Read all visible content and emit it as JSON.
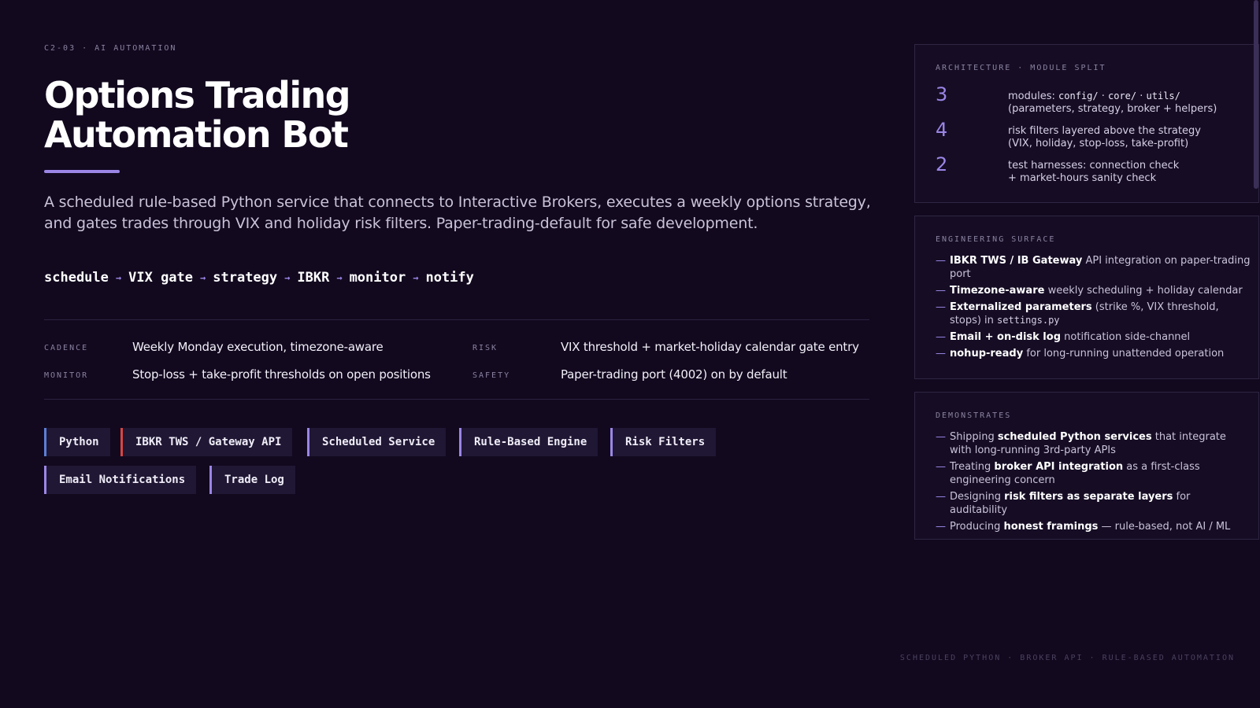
{
  "eyebrow": "C2-03 · AI AUTOMATION",
  "title": {
    "line1": "Options Trading",
    "line2": "Automation Bot"
  },
  "lede": "A scheduled rule-based Python service that connects to Interactive Brokers, executes a weekly options strategy, and gates trades through VIX and holiday risk filters. Paper-trading-default for safe development.",
  "pipeline": {
    "steps": [
      "schedule",
      "VIX gate",
      "strategy",
      "IBKR",
      "monitor",
      "notify"
    ],
    "arrow": "→"
  },
  "meta": {
    "cadence_label": "CADENCE",
    "cadence_value": "Weekly Monday execution, timezone-aware",
    "risk_label": "RISK",
    "risk_value": "VIX threshold + market-holiday calendar gate entry",
    "monitor_label": "MONITOR",
    "monitor_value": "Stop-loss + take-profit thresholds on open positions",
    "safety_label": "SAFETY",
    "safety_value": "Paper-trading port (4002) on by default"
  },
  "tags": [
    {
      "label": "Python",
      "accent": "#5b7fd6"
    },
    {
      "label": "IBKR TWS / Gateway API",
      "accent": "#d64545"
    },
    {
      "label": "Scheduled Service",
      "accent": "#9b86e6"
    },
    {
      "label": "Rule-Based Engine",
      "accent": "#9b86e6"
    },
    {
      "label": "Risk Filters",
      "accent": "#9b86e6"
    },
    {
      "label": "Email Notifications",
      "accent": "#9b86e6"
    },
    {
      "label": "Trade Log",
      "accent": "#9b86e6"
    }
  ],
  "architecture": {
    "title": "ARCHITECTURE · MODULE SPLIT",
    "rows": [
      {
        "num": "3",
        "prefix": "modules: ",
        "code1": "config/",
        "sep1": " · ",
        "code2": "core/",
        "sep2": " · ",
        "code3": "utils/",
        "line2": "(parameters, strategy, broker + helpers)"
      },
      {
        "num": "4",
        "line1": "risk filters layered above the strategy",
        "line2": "(VIX, holiday, stop-loss, take-profit)"
      },
      {
        "num": "2",
        "line1": "test harnesses: connection check",
        "line2": "+ market-hours sanity check"
      }
    ]
  },
  "engineering": {
    "title": "ENGINEERING SURFACE",
    "items": [
      {
        "bold": "IBKR TWS / IB Gateway",
        "rest": " API integration on paper-trading port"
      },
      {
        "bold": "Timezone-aware",
        "rest": " weekly scheduling + holiday calendar"
      },
      {
        "bold": "Externalized parameters",
        "rest": " (strike %, VIX threshold, stops) in ",
        "code": "settings.py"
      },
      {
        "bold": "Email + on-disk log",
        "rest": " notification side-channel"
      },
      {
        "bold": "nohup-ready",
        "rest": " for long-running unattended operation"
      }
    ]
  },
  "demonstrates": {
    "title": "DEMONSTRATES",
    "items": [
      {
        "pre": "Shipping ",
        "bold": "scheduled Python services",
        "rest": " that integrate with long-running 3rd-party APIs"
      },
      {
        "pre": "Treating ",
        "bold": "broker API integration",
        "rest": " as a first-class engineering concern"
      },
      {
        "pre": "Designing ",
        "bold": "risk filters as separate layers",
        "rest": " for auditability"
      },
      {
        "pre": "Producing ",
        "bold": "honest framings",
        "rest": " — rule-based, not AI / ML"
      }
    ]
  },
  "dash": "—",
  "footer": "SCHEDULED PYTHON · BROKER API · RULE-BASED AUTOMATION"
}
